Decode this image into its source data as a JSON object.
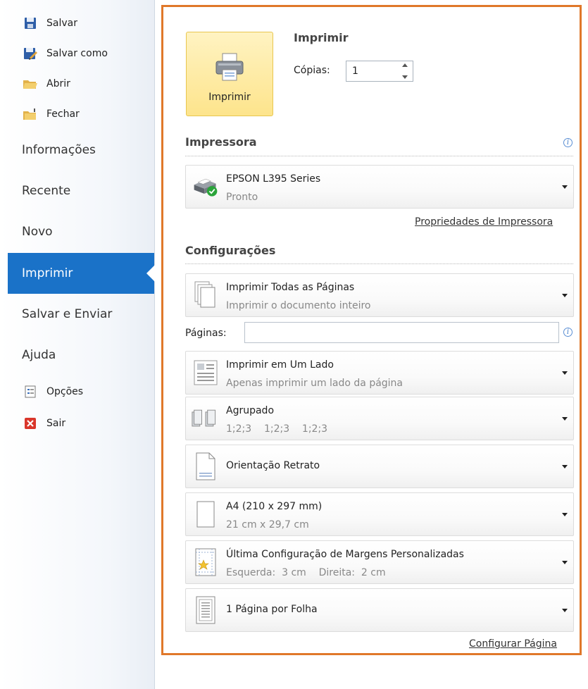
{
  "sidebar": {
    "save": "Salvar",
    "save_as": "Salvar como",
    "open": "Abrir",
    "close": "Fechar",
    "info": "Informações",
    "recent": "Recente",
    "new": "Novo",
    "print": "Imprimir",
    "save_send": "Salvar e Enviar",
    "help": "Ajuda",
    "options": "Opções",
    "exit": "Sair"
  },
  "print": {
    "button_label": "Imprimir",
    "title": "Imprimir",
    "copies_label": "Cópias:",
    "copies_value": "1"
  },
  "printer": {
    "section_title": "Impressora",
    "name": "EPSON L395 Series",
    "status": "Pronto",
    "properties_link": "Propriedades de Impressora"
  },
  "settings": {
    "section_title": "Configurações",
    "pages_label": "Páginas:",
    "pages_value": "",
    "items": [
      {
        "title": "Imprimir Todas as Páginas",
        "subtitle": "Imprimir o documento inteiro",
        "icon": "all-pages-icon"
      },
      {
        "title": "Imprimir em Um Lado",
        "subtitle": "Apenas imprimir um lado da página",
        "icon": "one-side-icon"
      },
      {
        "title": "Agrupado",
        "subtitle": "1;2;3    1;2;3    1;2;3",
        "icon": "collated-icon"
      },
      {
        "title": "Orientação Retrato",
        "subtitle": "",
        "icon": "portrait-icon"
      },
      {
        "title": "A4 (210 x 297 mm)",
        "subtitle": "21 cm x 29,7 cm",
        "icon": "paper-size-icon"
      },
      {
        "title": "Última Configuração de Margens Personalizadas",
        "subtitle": "Esquerda:  3 cm    Direita:  2 cm",
        "icon": "margins-icon"
      },
      {
        "title": "1 Página por Folha",
        "subtitle": "",
        "icon": "pages-per-sheet-icon"
      }
    ],
    "page_setup_link": "Configurar Página"
  },
  "colors": {
    "accent": "#1a72c8",
    "highlight_border": "#e0782a",
    "print_button": "#fde48c"
  }
}
